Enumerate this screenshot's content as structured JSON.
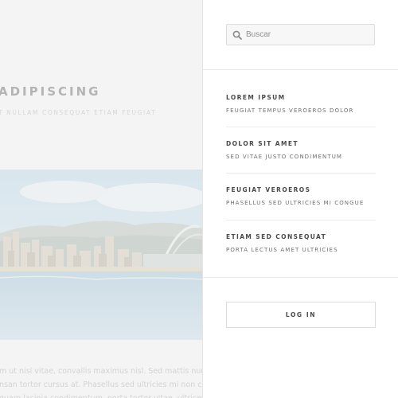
{
  "background": {
    "title": "ADIPISCING",
    "subtitle": "T NULLAM CONSEQUAT ETIAM FEUGIAT",
    "body_lines": [
      "m ut nisl vitae, convallis maximus nisl. Sed mattis nunc id lore",
      "nsan tortor cursus at. Phasellus sed ultricies mi non congue u",
      "quam lacinia condimentum, porta tortor vitae, ultrices maximus"
    ]
  },
  "sidebar": {
    "search": {
      "placeholder": "Buscar",
      "value": "",
      "icon": "search-icon"
    },
    "items": [
      {
        "title": "LOREM IPSUM",
        "desc": "FEUGIAT TEMPUS VEROEROS DOLOR"
      },
      {
        "title": "DOLOR SIT AMET",
        "desc": "SED VITAE JUSTO CONDIMENTUM"
      },
      {
        "title": "FEUGIAT VEROEROS",
        "desc": "PHASELLUS SED ULTRICIES MI CONGUE"
      },
      {
        "title": "ETIAM SED CONSEQUAT",
        "desc": "PORTA LECTUS AMET ULTRICIES"
      }
    ],
    "login_label": "LOG IN"
  },
  "colors": {
    "panel_bg": "#ffffff",
    "overlay_bg": "#f4f4f4",
    "heading": "#4a4a4a",
    "muted": "#6f6f6f"
  }
}
